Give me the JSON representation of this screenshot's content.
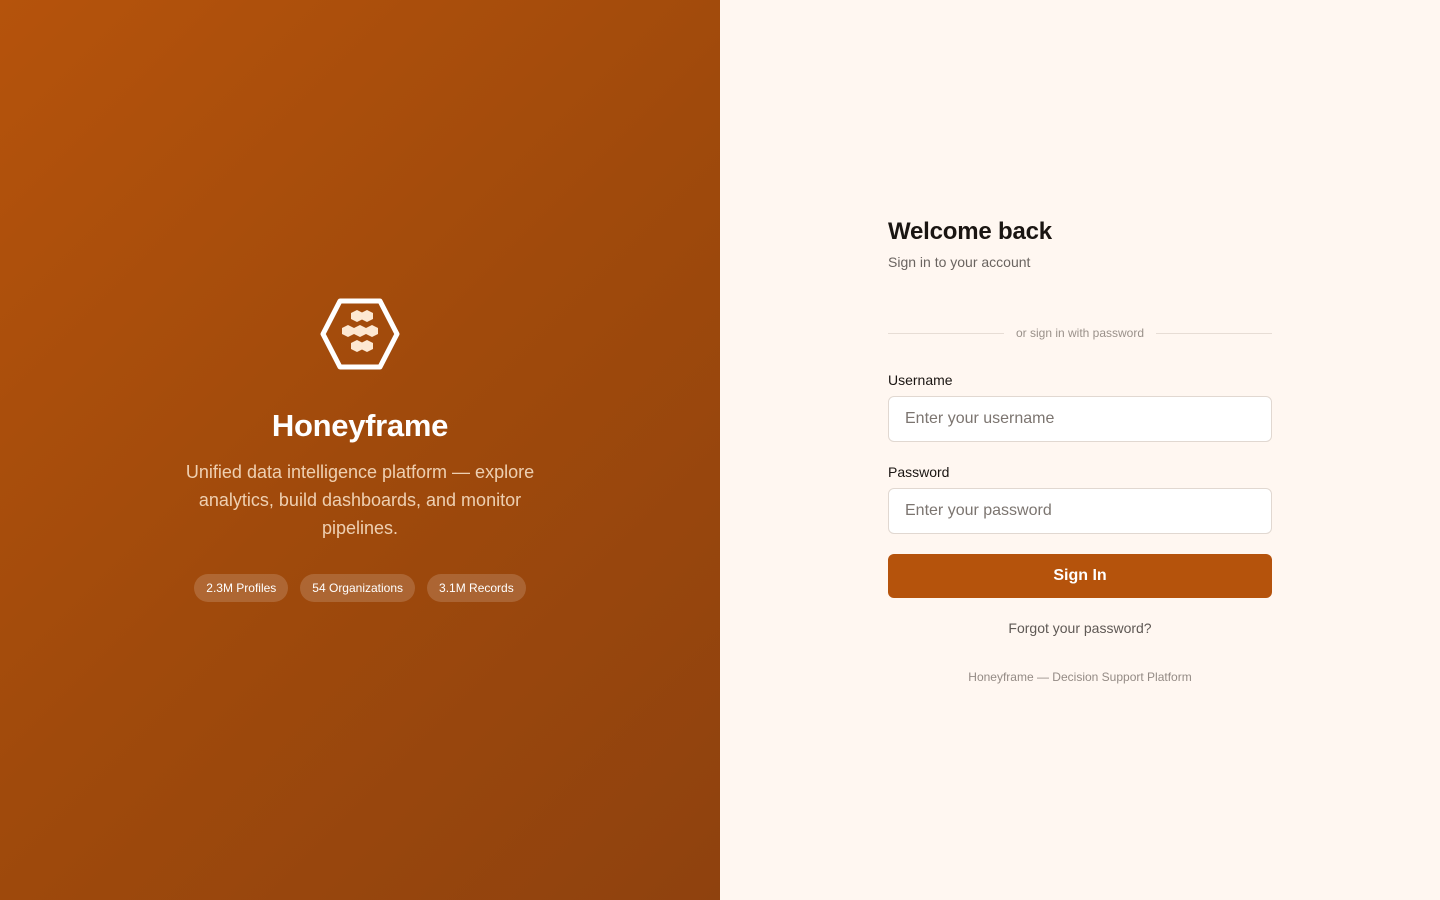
{
  "brand": {
    "name": "Honeyframe",
    "tagline": "Unified data intelligence platform — explore analytics, build dashboards, and monitor pipelines.",
    "stats": [
      "2.3M Profiles",
      "54 Organizations",
      "3.1M Records"
    ],
    "logo_icon": "honeycomb-hexagon-icon"
  },
  "login": {
    "title": "Welcome back",
    "subtitle": "Sign in to your account",
    "divider_text": "or sign in with password",
    "username_label": "Username",
    "username_placeholder": "Enter your username",
    "username_value": "",
    "password_label": "Password",
    "password_placeholder": "Enter your password",
    "password_value": "",
    "submit_label": "Sign In",
    "forgot_label": "Forgot your password?",
    "footer": "Honeyframe — Decision Support Platform"
  },
  "colors": {
    "brand_primary": "#b5530c",
    "brand_dark": "#8f420e",
    "form_background": "#fff7f1"
  }
}
